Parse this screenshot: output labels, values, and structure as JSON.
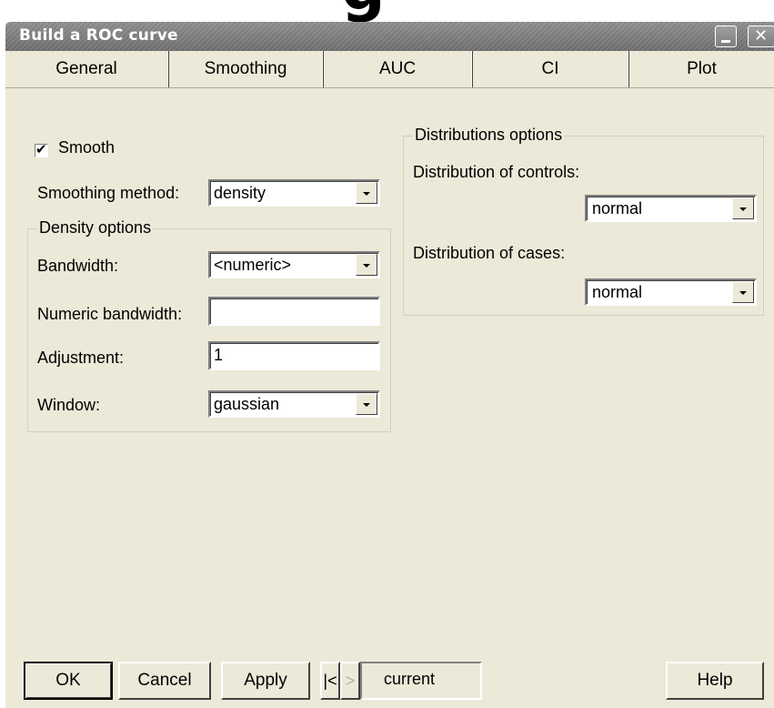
{
  "top_fragment": "g",
  "window": {
    "title": "Build a ROC curve",
    "minimize_label": "",
    "close_label": "✕"
  },
  "tabs": [
    {
      "label": "General"
    },
    {
      "label": "Smoothing"
    },
    {
      "label": "AUC"
    },
    {
      "label": "CI"
    },
    {
      "label": "Plot"
    }
  ],
  "active_tab": "Smoothing",
  "smoothing": {
    "smooth_checkbox": {
      "label": "Smooth",
      "checked": true,
      "mark": "✔"
    },
    "method": {
      "label": "Smoothing method:",
      "value": "density"
    },
    "density_options": {
      "title": "Density options",
      "bandwidth": {
        "label": "Bandwidth:",
        "value": "<numeric>"
      },
      "numeric_bandwidth": {
        "label": "Numeric bandwidth:",
        "value": ""
      },
      "adjustment": {
        "label": "Adjustment:",
        "value": "1"
      },
      "window": {
        "label": "Window:",
        "value": "gaussian"
      }
    },
    "distributions": {
      "title": "Distributions options",
      "controls": {
        "label": "Distribution of controls:",
        "value": "normal"
      },
      "cases": {
        "label": "Distribution of cases:",
        "value": "normal"
      }
    }
  },
  "footer": {
    "ok": "OK",
    "cancel": "Cancel",
    "apply": "Apply",
    "first": "|<",
    "prev": ">",
    "current": "current",
    "help": "Help"
  }
}
